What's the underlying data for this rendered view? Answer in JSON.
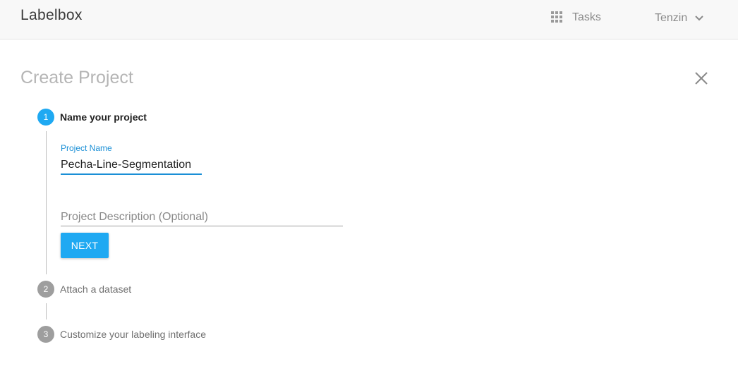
{
  "header": {
    "logo_text": "Labelbox",
    "apps_icon": "apps-grid-icon",
    "tasks_label": "Tasks",
    "user_name": "Tenzin",
    "user_menu_icon": "chevron-down-icon"
  },
  "page": {
    "title": "Create Project",
    "close_icon": "close-icon"
  },
  "steps": [
    {
      "number": "1",
      "label": "Name your project",
      "state": "active"
    },
    {
      "number": "2",
      "label": "Attach a dataset",
      "state": "inactive"
    },
    {
      "number": "3",
      "label": "Customize your labeling interface",
      "state": "inactive"
    }
  ],
  "form": {
    "name_label": "Project Name",
    "name_value": "Pecha-Line-Segmentation",
    "description_placeholder": "Project Description (Optional)",
    "description_value": "",
    "next_label": "NEXT"
  },
  "colors": {
    "accent": "#1fa9f2",
    "input_focus": "#1a8fd6",
    "inactive_step": "#9e9e9e"
  }
}
